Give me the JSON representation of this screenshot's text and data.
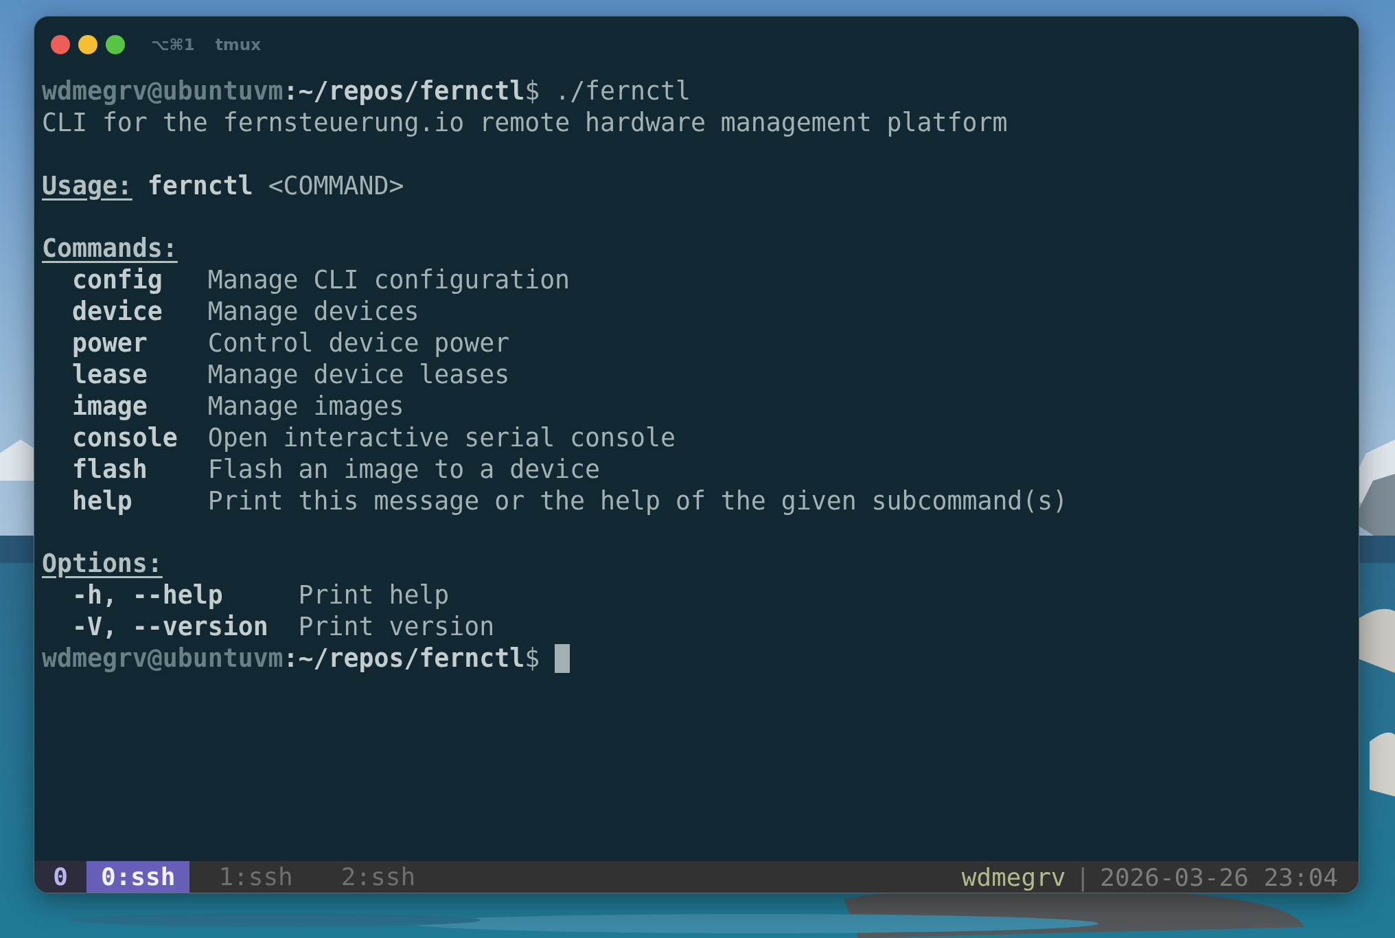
{
  "window": {
    "shortcut": "⌥⌘1",
    "title": "tmux"
  },
  "terminal": {
    "lines": [
      {
        "kind": "prompt",
        "user": "wdmegrv@ubuntuvm",
        "path": ":~/repos/fernctl",
        "sign": "$",
        "command": " ./fernctl",
        "cursor": false
      },
      {
        "kind": "text",
        "text": "CLI for the fernsteuerung.io remote hardware management platform"
      },
      {
        "kind": "blank"
      },
      {
        "kind": "usage",
        "label": "Usage:",
        "program": "fernctl",
        "args": "<COMMAND>"
      },
      {
        "kind": "blank"
      },
      {
        "kind": "section",
        "heading": "Commands:",
        "entries": [
          {
            "name": "config",
            "description": "Manage CLI configuration"
          },
          {
            "name": "device",
            "description": "Manage devices"
          },
          {
            "name": "power",
            "description": "Control device power"
          },
          {
            "name": "lease",
            "description": "Manage device leases"
          },
          {
            "name": "image",
            "description": "Manage images"
          },
          {
            "name": "console",
            "description": "Open interactive serial console"
          },
          {
            "name": "flash",
            "description": "Flash an image to a device"
          },
          {
            "name": "help",
            "description": "Print this message or the help of the given subcommand(s)"
          }
        ]
      },
      {
        "kind": "blank"
      },
      {
        "kind": "section",
        "heading": "Options:",
        "entries": [
          {
            "name": "-h, --help",
            "description": "Print help"
          },
          {
            "name": "-V, --version",
            "description": "Print version"
          }
        ]
      },
      {
        "kind": "prompt",
        "user": "wdmegrv@ubuntuvm",
        "path": ":~/repos/fernctl",
        "sign": "$",
        "cursor": true
      }
    ]
  },
  "status_bar": {
    "session": "0",
    "windows": [
      {
        "label": "0:ssh",
        "selected": true
      },
      {
        "label": "1:ssh",
        "selected": false
      },
      {
        "label": "2:ssh",
        "selected": false
      }
    ],
    "user": "wdmegrv",
    "separator": "|",
    "clock": "2026-03-26 23:04"
  }
}
